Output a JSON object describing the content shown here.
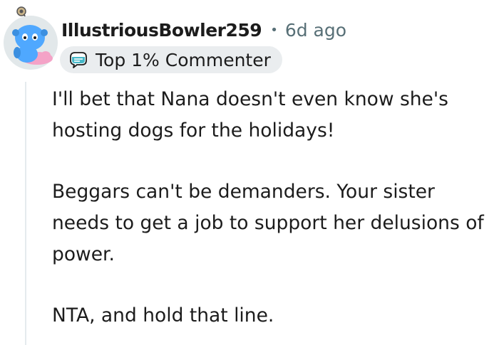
{
  "comment": {
    "username": "IllustriousBowler259",
    "separator": "•",
    "timestamp": "6d ago",
    "flair": {
      "label": "Top 1% Commenter",
      "icon": "commenter-badge-icon"
    },
    "avatar": {
      "icon": "snoo-avatar-icon"
    },
    "paragraphs": [
      "I'll bet that Nana doesn't even know she's hosting dogs for the holidays!",
      "Beggars can't be demanders. Your sister needs to get a job to support her delusions of power.",
      "NTA, and hold that line."
    ]
  },
  "colors": {
    "text": "#1c1c1c",
    "meta": "#576f76",
    "flair_bg": "#eaedef",
    "thread_line": "#e5ebee",
    "avatar_blue": "#4fa8ff",
    "avatar_pink": "#f4a3c7"
  }
}
